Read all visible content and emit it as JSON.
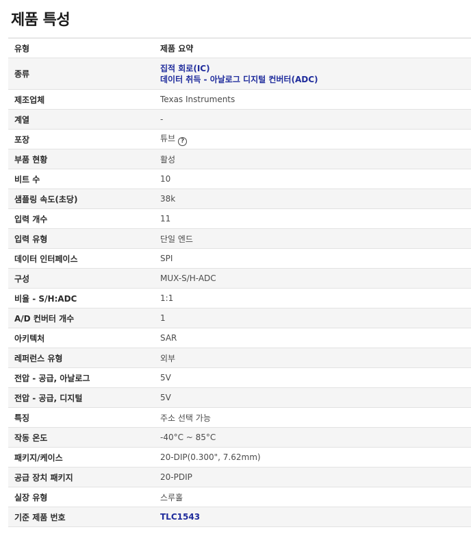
{
  "page_title": "제품 특성",
  "header": {
    "type_label": "유형",
    "summary_label": "제품 요약"
  },
  "category": {
    "label": "종류",
    "link1": "집적 회로(IC)",
    "link2": "데이터 취득 - 아날로그 디지털 컨버터(ADC)"
  },
  "rows": {
    "manufacturer": {
      "label": "제조업체",
      "value": "Texas Instruments"
    },
    "series": {
      "label": "계열",
      "value": "-"
    },
    "packaging": {
      "label": "포장",
      "value": "튜브",
      "icon": "help-icon"
    },
    "part_status": {
      "label": "부품 현황",
      "value": "활성"
    },
    "bits": {
      "label": "비트 수",
      "value": "10"
    },
    "sample_rate": {
      "label": "샘플링 속도(초당)",
      "value": "38k"
    },
    "inputs": {
      "label": "입력 개수",
      "value": "11"
    },
    "input_type": {
      "label": "입력 유형",
      "value": "단일 엔드"
    },
    "data_interface": {
      "label": "데이터 인터페이스",
      "value": "SPI"
    },
    "configuration": {
      "label": "구성",
      "value": "MUX-S/H-ADC"
    },
    "ratio": {
      "label": "비율 - S/H:ADC",
      "value": "1:1"
    },
    "ad_converters": {
      "label": "A/D 컨버터 개수",
      "value": "1"
    },
    "architecture": {
      "label": "아키텍처",
      "value": "SAR"
    },
    "reference_type": {
      "label": "레퍼런스 유형",
      "value": "외부"
    },
    "voltage_analog": {
      "label": "전압 - 공급, 아날로그",
      "value": "5V"
    },
    "voltage_digital": {
      "label": "전압 - 공급, 디지털",
      "value": "5V"
    },
    "features": {
      "label": "특징",
      "value": "주소 선택 가능"
    },
    "operating_temp": {
      "label": "작동 온도",
      "value": "-40°C ~ 85°C"
    },
    "package_case": {
      "label": "패키지/케이스",
      "value": "20-DIP(0.300\", 7.62mm)"
    },
    "supplier_package": {
      "label": "공급 장치 패키지",
      "value": "20-PDIP"
    },
    "mounting_type": {
      "label": "실장 유형",
      "value": "스루홀"
    },
    "base_part": {
      "label": "기준 제품 번호",
      "value": "TLC1543"
    }
  }
}
